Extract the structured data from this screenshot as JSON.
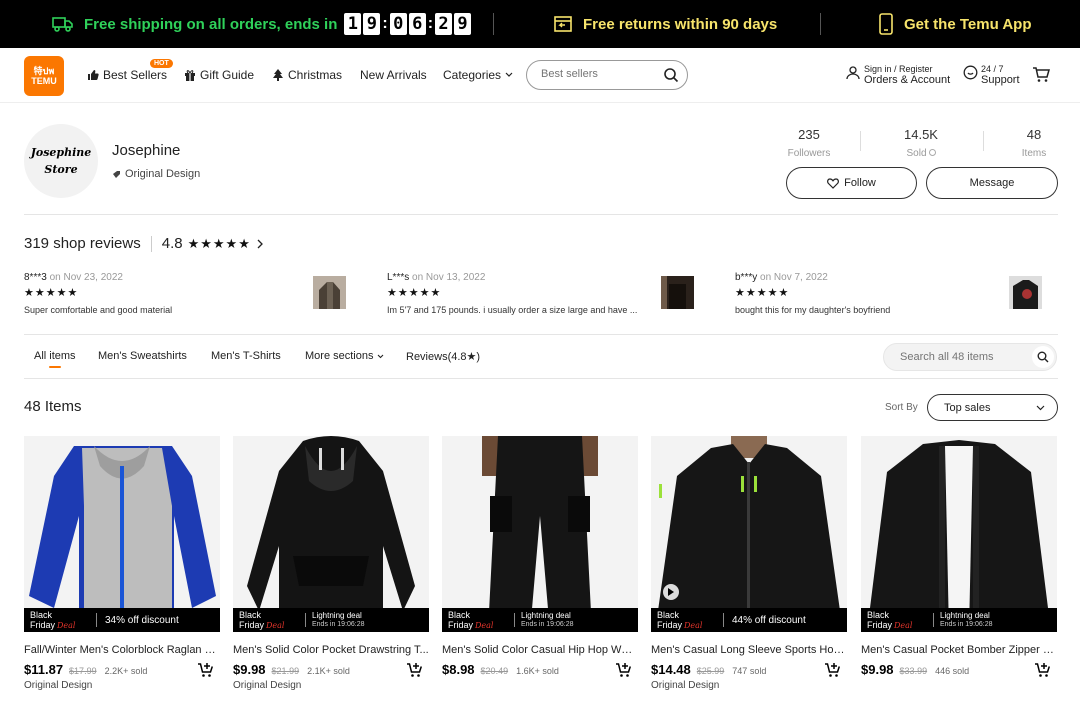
{
  "promo": {
    "shipping_text": "Free shipping on all orders, ends in",
    "timer": [
      "1",
      "9",
      "0",
      "6",
      "2",
      "9"
    ],
    "returns_text": "Free returns within 90 days",
    "app_text": "Get the Temu App"
  },
  "header": {
    "logo_line1": "特ปพ",
    "logo_line2": "TEMU",
    "nav": [
      "Best Sellers",
      "Gift Guide",
      "Christmas",
      "New Arrivals",
      "Categories"
    ],
    "hot_badge": "HOT",
    "search_placeholder": "Best sellers",
    "account_small": "Sign in / Register",
    "account_main": "Orders & Account",
    "support_small": "24 / 7",
    "support_main": "Support"
  },
  "store": {
    "avatar_line1": "Josephine",
    "avatar_line2": "Store",
    "name": "Josephine",
    "tag": "Original Design",
    "stats": [
      {
        "value": "235",
        "label": "Followers"
      },
      {
        "value": "14.5K",
        "label": "Sold"
      },
      {
        "value": "48",
        "label": "Items"
      }
    ],
    "follow_label": "Follow",
    "message_label": "Message"
  },
  "reviews": {
    "count_label": "319 shop reviews",
    "rating": "4.8",
    "stars": "★★★★★",
    "items": [
      {
        "user": "8***3",
        "date": "on Nov 23, 2022",
        "stars": "★★★★★",
        "text": "Super comfortable and good material"
      },
      {
        "user": "L***s",
        "date": "on Nov 13, 2022",
        "stars": "★★★★★",
        "text": "Im 5'7 and 175 pounds. i usually order a size large and have ..."
      },
      {
        "user": "b***y",
        "date": "on Nov 7, 2022",
        "stars": "★★★★★",
        "text": "bought this for my daughter's boyfriend"
      }
    ]
  },
  "tabs": [
    "All items",
    "Men's Sweatshirts",
    "Men's T-Shirts",
    "More sections",
    "Reviews(4.8★)"
  ],
  "store_search_placeholder": "Search all 48 items",
  "listing": {
    "title": "48 Items",
    "sort_label": "Sort By",
    "sort_value": "Top sales"
  },
  "products": [
    {
      "title": "Fall/Winter Men's Colorblock Raglan Sl...",
      "price": "$11.87",
      "orig": "$17.99",
      "sold": "2.2K+ sold",
      "tag": "Original Design",
      "badge": "Black Friday",
      "badge_script": "Deal",
      "deal": "34% off discount"
    },
    {
      "title": "Men's Solid Color Pocket Drawstring T...",
      "price": "$9.98",
      "orig": "$21.99",
      "sold": "2.1K+ sold",
      "tag": "Original Design",
      "badge": "Black Friday",
      "badge_script": "Deal",
      "deal_a": "Lightning deal",
      "deal_b": "Ends in 19:06:28"
    },
    {
      "title": "Men's Solid Color Casual Hip Hop Work...",
      "price": "$8.98",
      "orig": "$20.49",
      "sold": "1.6K+ sold",
      "tag": "",
      "badge": "Black Friday",
      "badge_script": "Deal",
      "deal_a": "Lightning deal",
      "deal_b": "Ends in 19:06:28"
    },
    {
      "title": "Men's Casual Long Sleeve Sports Hood...",
      "price": "$14.48",
      "orig": "$25.99",
      "sold": "747 sold",
      "tag": "Original Design",
      "badge": "Black Friday",
      "badge_script": "Deal",
      "deal": "44% off discount"
    },
    {
      "title": "Men's Casual Pocket Bomber Zipper Ja...",
      "price": "$9.98",
      "orig": "$33.99",
      "sold": "446 sold",
      "tag": "",
      "badge": "Black Friday",
      "badge_script": "Deal",
      "deal_a": "Lightning deal",
      "deal_b": "Ends in 19:06:28"
    }
  ],
  "colors": {
    "brand": "#fb7701",
    "promo_green": "#2fd15a",
    "promo_yellow": "#f7e46b"
  }
}
